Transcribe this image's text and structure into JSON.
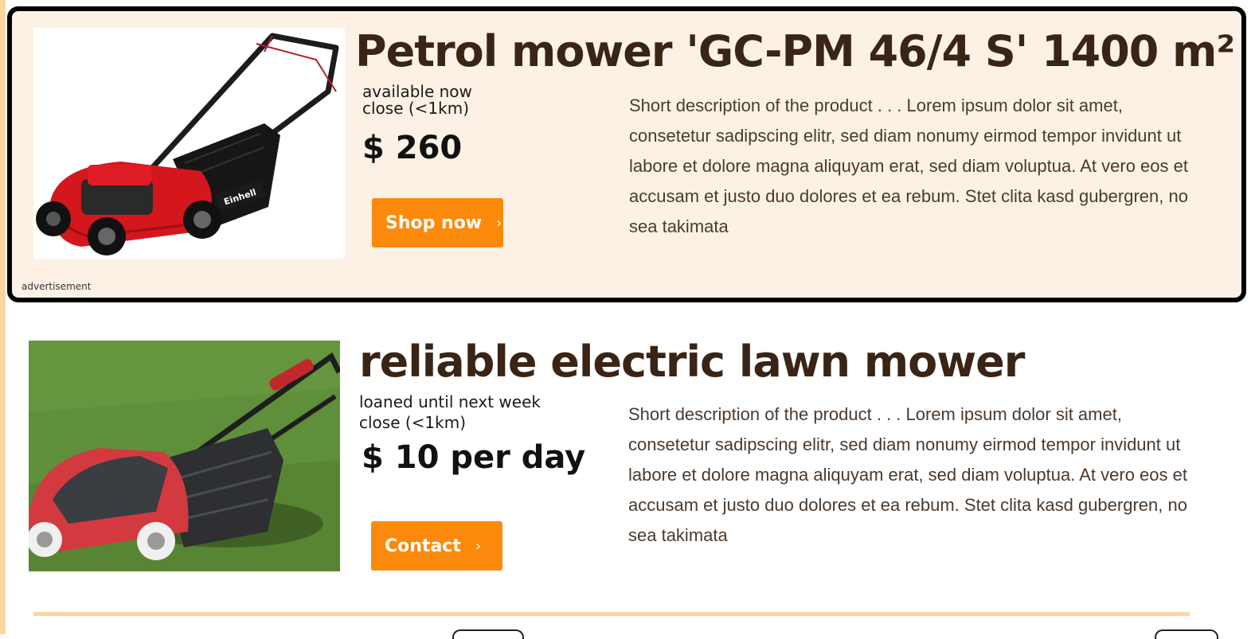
{
  "listings": [
    {
      "title": "Petrol mower 'GC-PM 46/4 S' 1400 m²",
      "availability": "available now",
      "distance": "close (<1km)",
      "price": "$ 260",
      "cta_label": "Shop now",
      "description": "Short description of the product  . . . Lorem ipsum dolor sit amet, consetetur sadipscing elitr, sed diam nonumy eirmod tempor invidunt ut labore et dolore magna aliquyam erat, sed diam voluptua. At vero eos et accusam et justo duo dolores et ea rebum. Stet clita kasd gubergren, no sea takimata",
      "ad_label": "advertisement",
      "photo_brand": "Einhell"
    },
    {
      "title": "reliable electric lawn mower",
      "availability": "loaned until next week",
      "distance": "close (<1km)",
      "price": "$ 10 per day",
      "cta_label": "Contact",
      "description": "Short description of the product  . . . Lorem ipsum dolor sit amet, consetetur sadipscing elitr, sed diam nonumy eirmod tempor invidunt ut labore et dolore magna aliquyam erat, sed diam voluptua. At vero eos et accusam et justo duo dolores et ea rebum. Stet clita kasd gubergren, no sea takimata"
    }
  ],
  "icons": {
    "cta_chevron": "chevron-right-icon"
  },
  "colors": {
    "accent": "#fb8a0c",
    "ad_background": "#fdf1e5",
    "rail": "#fbd6a2",
    "title_text": "#3a2416"
  }
}
